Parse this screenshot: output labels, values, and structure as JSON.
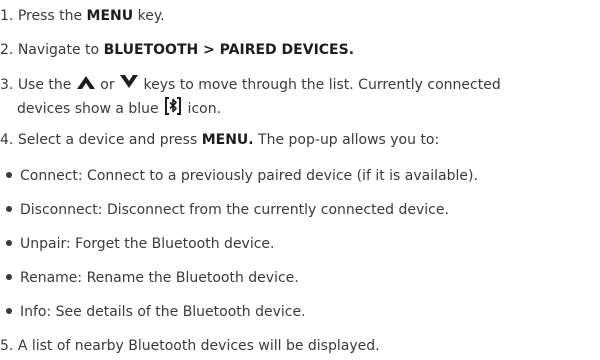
{
  "steps": [
    {
      "num": "1.",
      "pre": "Press the ",
      "bold": "MENU",
      "post": " key."
    },
    {
      "num": "2.",
      "pre": "Navigate to ",
      "bold": "BLUETOOTH > PAIRED DEVICES.",
      "post": ""
    },
    {
      "num": "3.",
      "pre": "Use the ",
      "mid": " or ",
      "post": " keys to move through the list. Currently connected",
      "line2_pre": "devices show a blue ",
      "line2_post": " icon."
    },
    {
      "num": "4.",
      "pre": "Select a device and press ",
      "bold": "MENU.",
      "post": " The pop-up allows you to:"
    },
    {
      "num": "5.",
      "text": "A list of nearby Bluetooth devices will be displayed."
    }
  ],
  "options": [
    "Connect: Connect to a previously paired device (if it is available).",
    "Disconnect: Disconnect from the currently connected device.",
    "Unpair: Forget the Bluetooth device.",
    "Rename: Rename the Bluetooth device.",
    "Info: See details of the Bluetooth device."
  ],
  "icons": {
    "up": "up-arrow-icon",
    "down": "down-arrow-icon",
    "bluetooth": "bluetooth-connected-icon"
  },
  "colors": {
    "text": "#3a3a3a",
    "icon": "#1e1e1e"
  }
}
